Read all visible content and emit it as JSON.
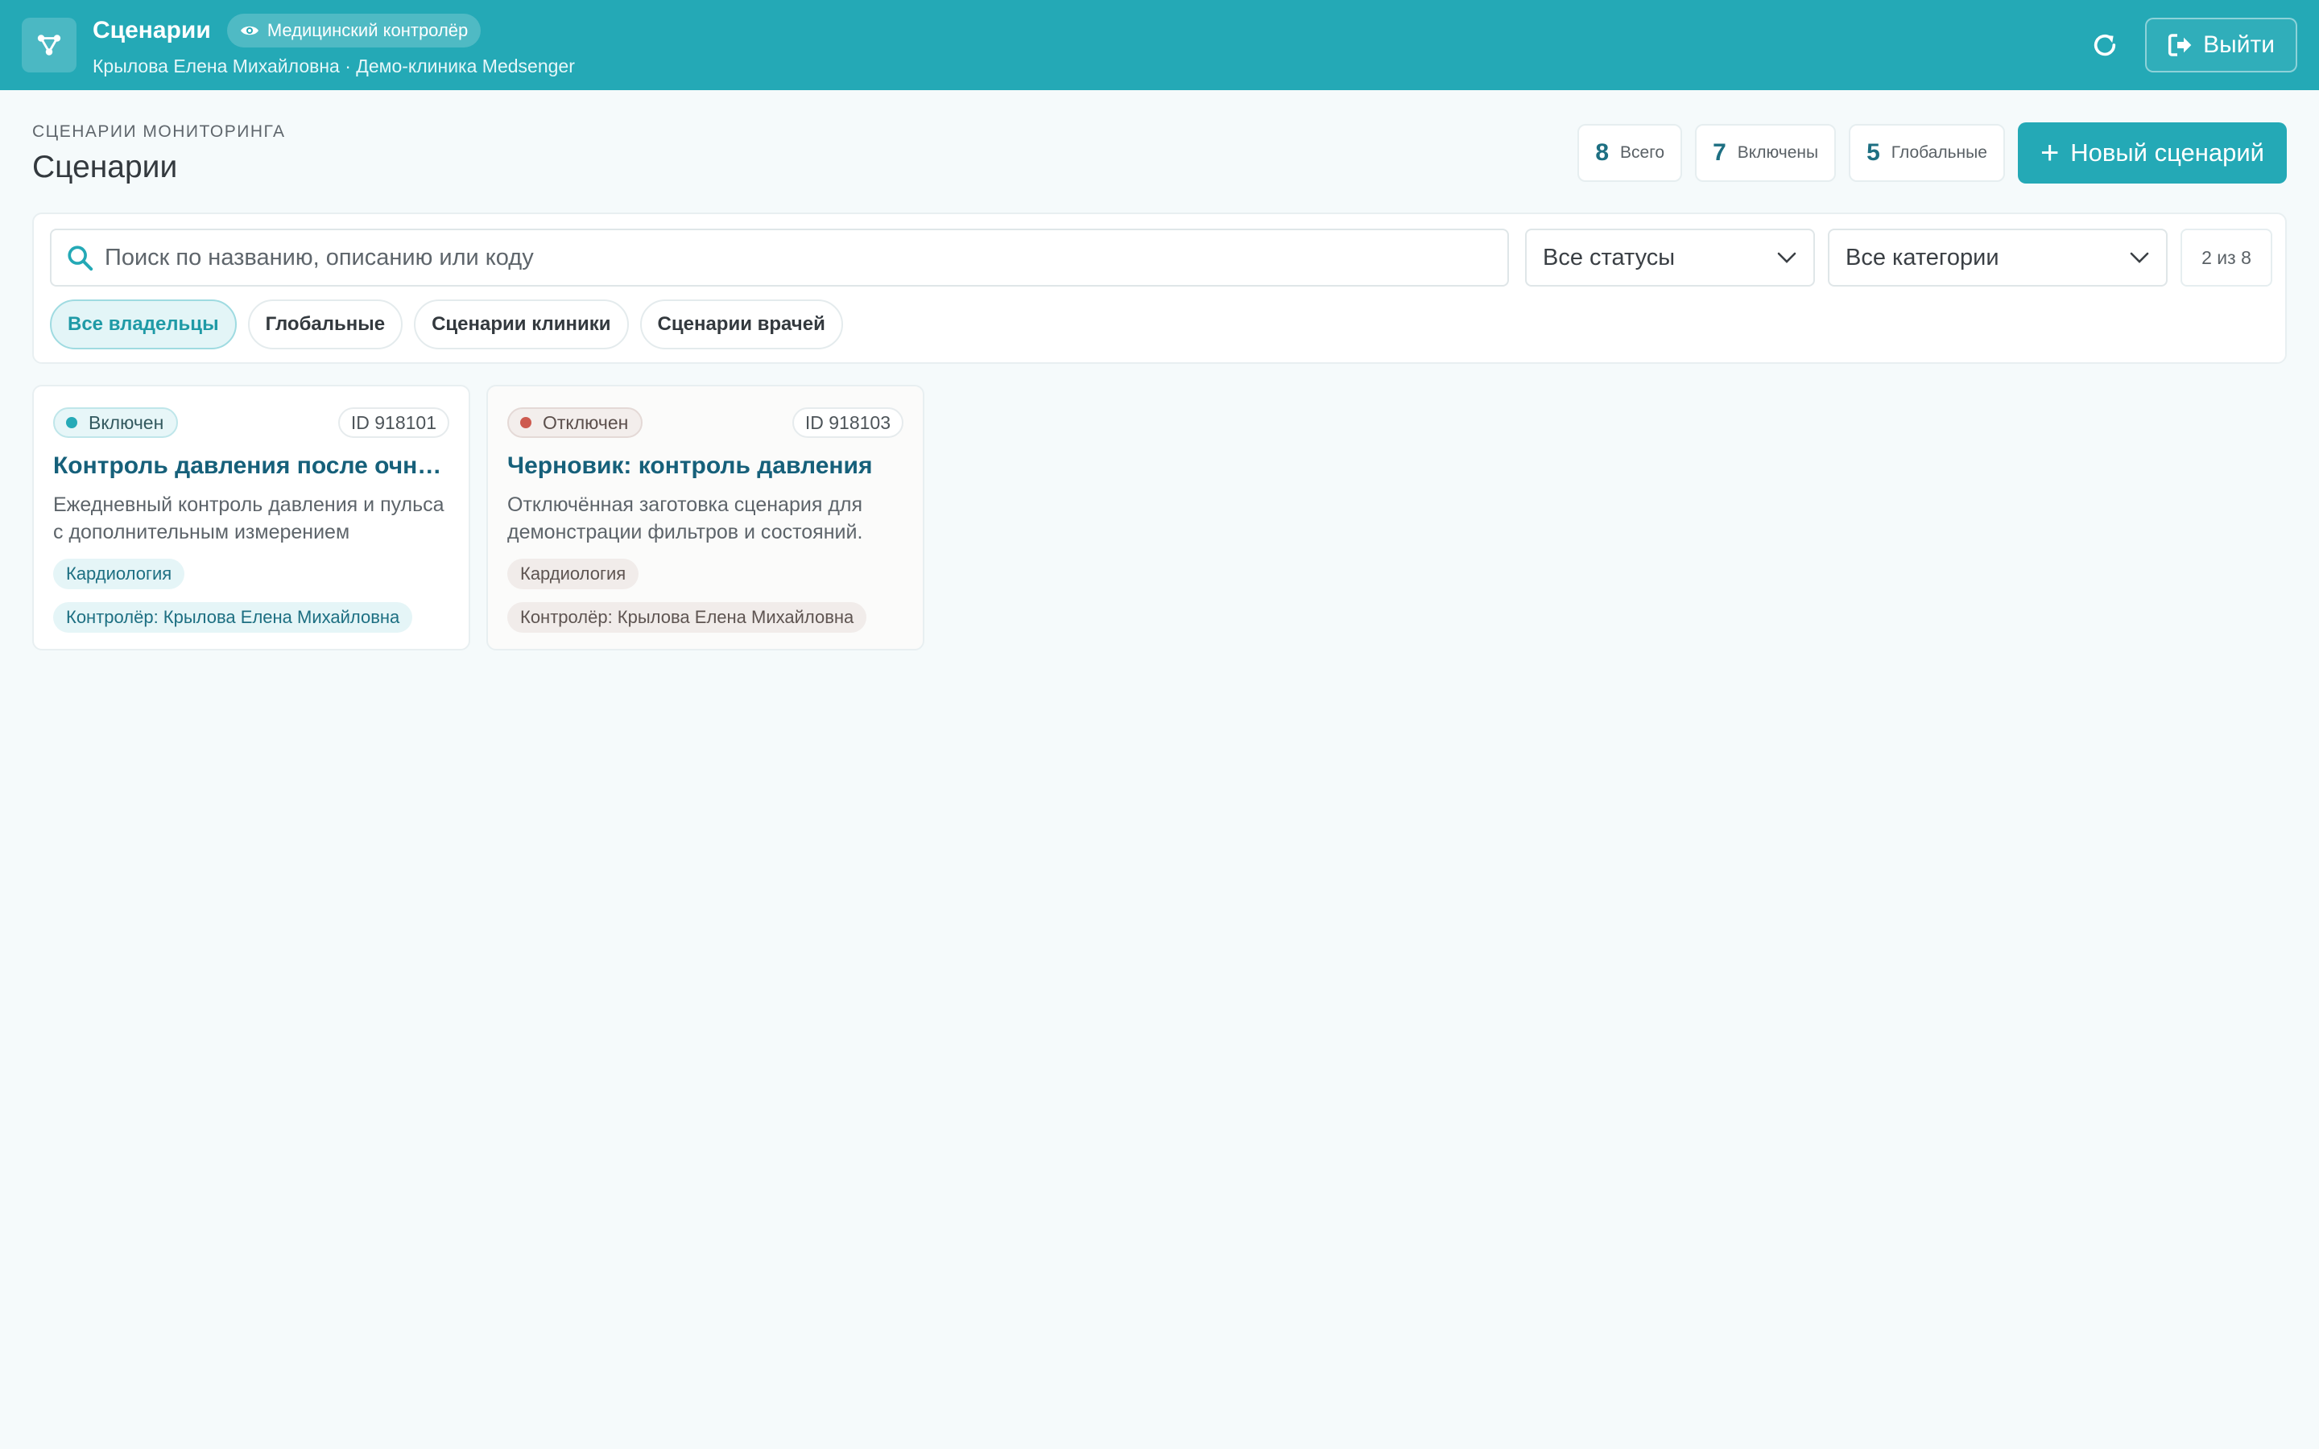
{
  "header": {
    "title": "Сценарии",
    "role": "Медицинский контролёр",
    "user_line": "Крылова Елена Михайловна · Демо-клиника Medsenger",
    "logout_label": "Выйти"
  },
  "page": {
    "eyebrow": "СЦЕНАРИИ МОНИТОРИНГА",
    "title": "Сценарии"
  },
  "stats": [
    {
      "num": "8",
      "label": "Всего"
    },
    {
      "num": "7",
      "label": "Включены"
    },
    {
      "num": "5",
      "label": "Глобальные"
    }
  ],
  "new_button_label": "Новый сценарий",
  "filters": {
    "search_placeholder": "Поиск по названию, описанию или коду",
    "status_value": "Все статусы",
    "category_value": "Все категории",
    "count": "2 из 8",
    "chips": [
      "Все владельцы",
      "Глобальные",
      "Сценарии клиники",
      "Сценарии врачей"
    ]
  },
  "cards": [
    {
      "status": "Включен",
      "id": "ID 918101",
      "title": "Контроль давления после очного приема",
      "description": "Ежедневный контроль давления и пульса с дополнительным измерением",
      "category": "Кардиология",
      "controller": "Контролёр: Крылова Елена Михайловна"
    },
    {
      "status": "Отключен",
      "id": "ID 918103",
      "title": "Черновик: контроль давления",
      "description": "Отключённая заготовка сценария для демонстрации фильтров и состояний.",
      "category": "Кардиология",
      "controller": "Контролёр: Крылова Елена Михайловна"
    }
  ],
  "colors": {
    "brand": "#24a9b6",
    "enabled": "#26aab7",
    "disabled": "#cd5a4f"
  }
}
